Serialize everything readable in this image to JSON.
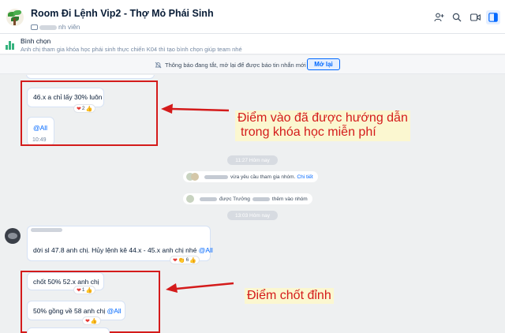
{
  "header": {
    "title": "Room Đi Lệnh Vip2 - Thợ Mỏ Phái Sinh",
    "member_suffix": "nh viên",
    "icons": [
      "add-member-icon",
      "search-icon",
      "video-call-icon",
      "sidebar-toggle-icon"
    ]
  },
  "poll": {
    "title": "Bình chọn",
    "description": "Anh chị tham gia khóa học phái sinh thực chiến K04 thì tạo bình chọn giúp team nhé"
  },
  "notice": {
    "text": "Thông báo đang tắt, mở lại để được báo tin nhắn mới",
    "button": "Mở lại"
  },
  "messages": {
    "m1_text": "46.x a chỉ lấy 30% luôn",
    "m1_react_count": "2",
    "m2_mention": "@All",
    "m2_time": "10:49",
    "m3_text": "dời sl 47.8 anh chị. Hủy lệnh kê 44.x - 45.x anh chị nhé ",
    "m3_mention": "@All",
    "m3_react_count": "6",
    "m4_text": "chốt 50% 52.x anh chị",
    "m4_react_count": "1",
    "m5_text": "50% gồng về 58 anh chị ",
    "m5_mention": "@All"
  },
  "system": {
    "divider1": "11:27 Hôm nay",
    "join_request": "vừa yêu cầu tham gia nhóm.",
    "join_link": "Chi tiết",
    "added_text1": "được Trưởng",
    "added_text2": "thêm vào nhóm",
    "divider2": "13:03 Hôm nay"
  },
  "annotations": {
    "a1_line1": "Điểm vào đã được hướng dẫn",
    "a1_line2": "trong khóa học miễn phí",
    "a2": "Điểm chốt đỉnh"
  },
  "colors": {
    "accent": "#0068ff",
    "annotation_red": "#d41b1b",
    "annotation_bg": "#fbf7d0"
  }
}
